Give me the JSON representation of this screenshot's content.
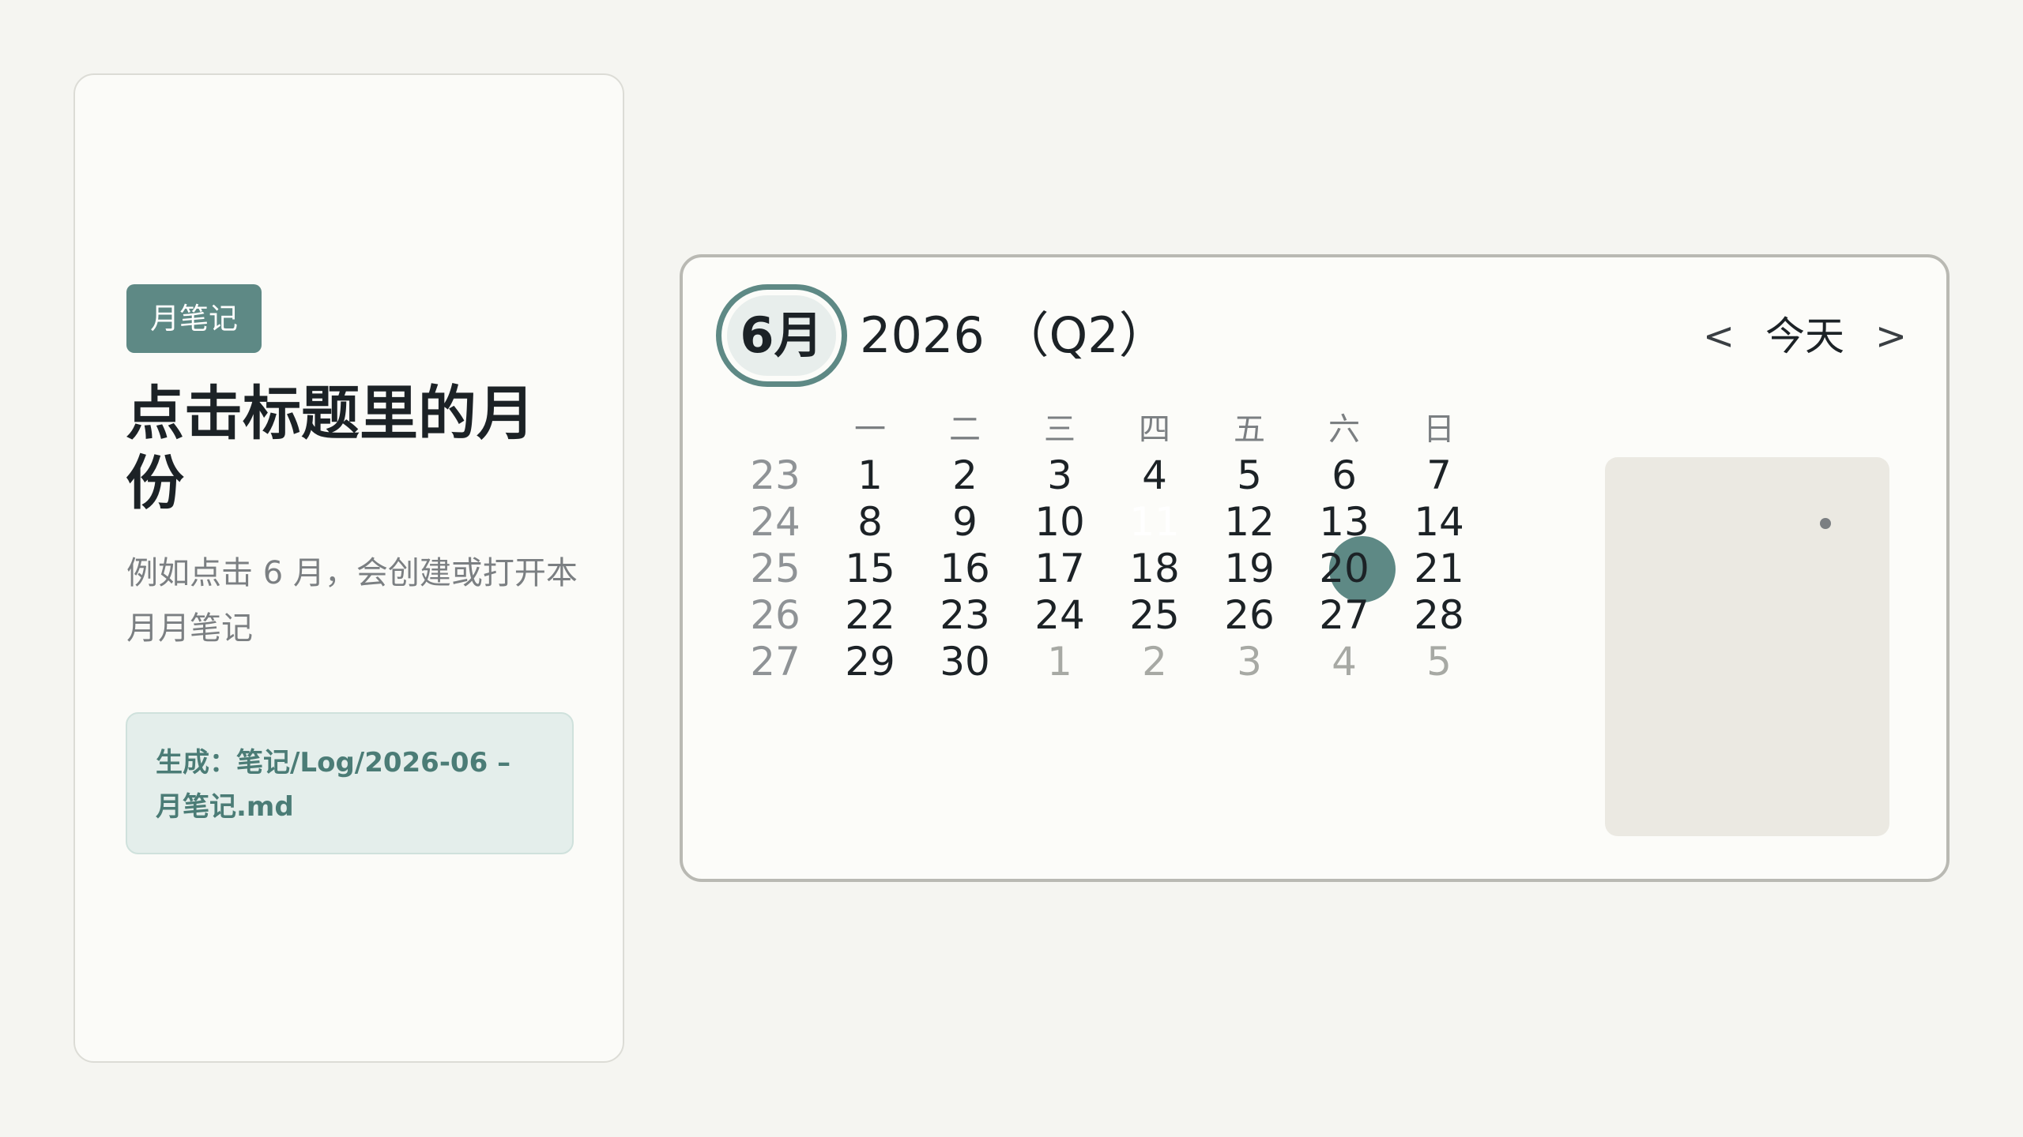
{
  "side": {
    "tag": "月笔记",
    "title": "点击标题里的月份",
    "desc": "例如点击 6 月，会创建或打开本月月笔记",
    "generated": "生成：笔记/Log/2026-06 – 月笔记.md"
  },
  "calendar": {
    "month": "6月",
    "year": "2026 （Q2）",
    "prev": "<",
    "today": "今天",
    "next": ">",
    "weekdays": [
      "一",
      "二",
      "三",
      "四",
      "五",
      "六",
      "日"
    ],
    "weeks": [
      {
        "wk": "23",
        "days": [
          "1",
          "2",
          "3",
          "4",
          "5",
          "6",
          "7"
        ]
      },
      {
        "wk": "24",
        "days": [
          "8",
          "9",
          "10",
          "11",
          "12",
          "13",
          "14"
        ]
      },
      {
        "wk": "25",
        "days": [
          "15",
          "16",
          "17",
          "18",
          "19",
          "20",
          "21"
        ]
      },
      {
        "wk": "26",
        "days": [
          "22",
          "23",
          "24",
          "25",
          "26",
          "27",
          "28"
        ]
      },
      {
        "wk": "27",
        "days": [
          "29",
          "30",
          "1",
          "2",
          "3",
          "4",
          "5"
        ]
      }
    ],
    "today_date": "11",
    "note_dot_date": "7",
    "accent_color": "#5e8985",
    "weekend_band_color": "#ebe9e2"
  }
}
